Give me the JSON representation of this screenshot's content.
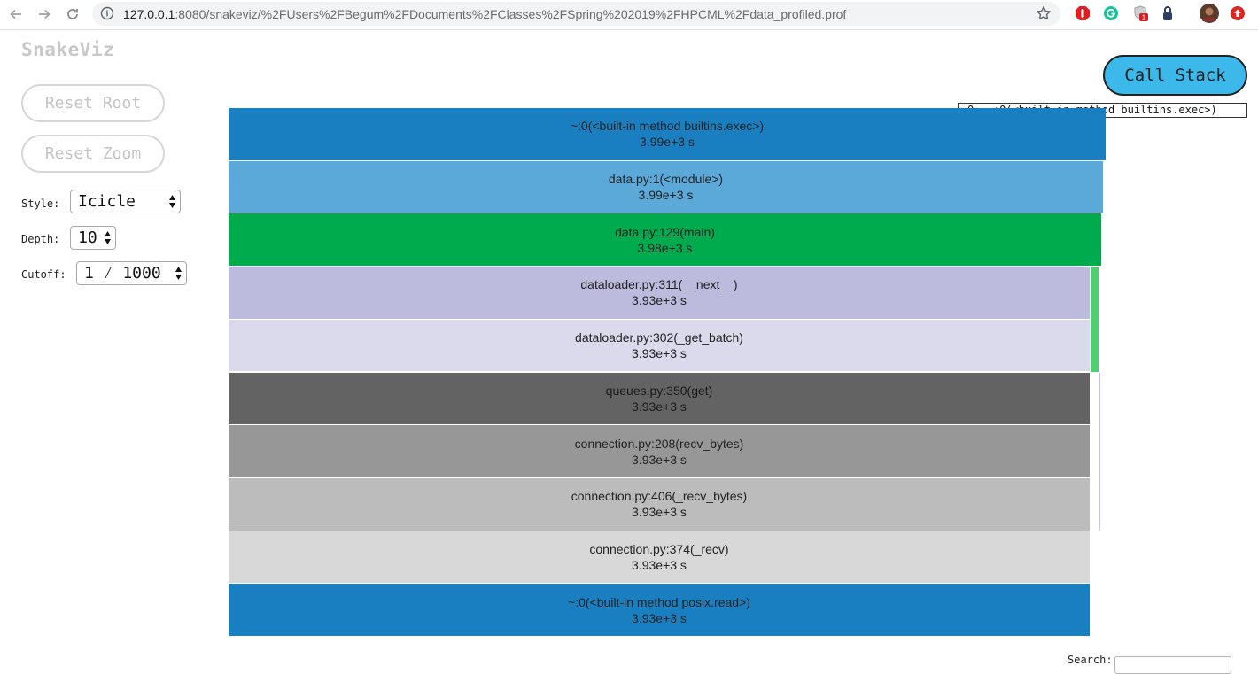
{
  "browser": {
    "url_host": "127.0.0.1",
    "url_rest": ":8080/snakeviz/%2FUsers%2FBegum%2FDocuments%2FClasses%2FSpring%202019%2FHPCML%2Fdata_profiled.prof",
    "ext_badge": "1"
  },
  "app": {
    "title": "SnakeViz",
    "reset_root": "Reset Root",
    "reset_zoom": "Reset Zoom"
  },
  "controls": {
    "style_label": "Style:",
    "style_value": "Icicle",
    "depth_label": "Depth:",
    "depth_value": "10",
    "cutoff_label": "Cutoff:",
    "cutoff_value": "1 ⁄ 1000"
  },
  "callstack": {
    "button": "Call Stack",
    "items": [
      "0. ~:0(<built-in method builtins.exec>)"
    ]
  },
  "icicle": {
    "rows": [
      {
        "name": "~:0(<built-in method builtins.exec>)",
        "time": "3.99e+3 s",
        "color": "#1a7fc1",
        "fraction": 1.0
      },
      {
        "name": "data.py:1(<module>)",
        "time": "3.99e+3 s",
        "color": "#5ba9d8",
        "fraction": 0.997
      },
      {
        "name": "data.py:129(main)",
        "time": "3.98e+3 s",
        "color": "#00ab4e",
        "fraction": 0.995
      },
      {
        "name": "dataloader.py:311(__next__)",
        "time": "3.93e+3 s",
        "color": "#bcbadd",
        "fraction": 0.982
      },
      {
        "name": "dataloader.py:302(_get_batch)",
        "time": "3.93e+3 s",
        "color": "#dbd9ec",
        "fraction": 0.982
      },
      {
        "name": "queues.py:350(get)",
        "time": "3.93e+3 s",
        "color": "#636363",
        "fraction": 0.982
      },
      {
        "name": "connection.py:208(recv_bytes)",
        "time": "3.93e+3 s",
        "color": "#979797",
        "fraction": 0.982
      },
      {
        "name": "connection.py:406(_recv_bytes)",
        "time": "3.93e+3 s",
        "color": "#bcbcbc",
        "fraction": 0.982
      },
      {
        "name": "connection.py:374(_recv)",
        "time": "3.93e+3 s",
        "color": "#d8d8d8",
        "fraction": 0.982
      },
      {
        "name": "~:0(<built-in method posix.read>)",
        "time": "3.93e+3 s",
        "color": "#1a7fc1",
        "fraction": 0.982
      }
    ]
  },
  "search": {
    "label": "Search:"
  }
}
